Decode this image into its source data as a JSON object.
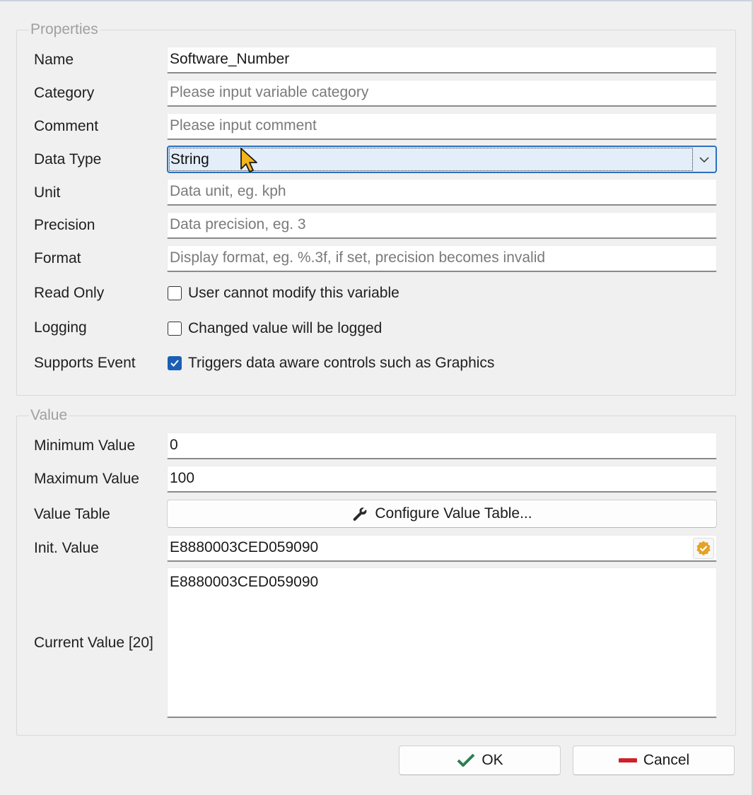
{
  "properties": {
    "legend": "Properties",
    "name": {
      "label": "Name",
      "value": "Software_Number"
    },
    "category": {
      "label": "Category",
      "placeholder": "Please input variable category"
    },
    "comment": {
      "label": "Comment",
      "placeholder": "Please input comment"
    },
    "data_type": {
      "label": "Data Type",
      "selected": "String"
    },
    "unit": {
      "label": "Unit",
      "placeholder": "Data unit, eg. kph"
    },
    "precision": {
      "label": "Precision",
      "placeholder": "Data precision, eg. 3"
    },
    "format": {
      "label": "Format",
      "placeholder": "Display format, eg. %.3f, if set, precision becomes invalid"
    },
    "read_only": {
      "label": "Read Only",
      "text": "User cannot modify this variable",
      "checked": false
    },
    "logging": {
      "label": "Logging",
      "text": "Changed value will be logged",
      "checked": false
    },
    "supports_event": {
      "label": "Supports Event",
      "text": "Triggers data aware controls such as Graphics",
      "checked": true
    }
  },
  "value": {
    "legend": "Value",
    "minimum": {
      "label": "Minimum Value",
      "value": "0"
    },
    "maximum": {
      "label": "Maximum Value",
      "value": "100"
    },
    "value_table": {
      "label": "Value Table",
      "button": "Configure Value Table..."
    },
    "init_value": {
      "label": "Init. Value",
      "value": "E8880003CED059090"
    },
    "current_value": {
      "label": "Current Value [20]",
      "value": "E8880003CED059090"
    }
  },
  "buttons": {
    "ok": "OK",
    "cancel": "Cancel"
  },
  "colors": {
    "accent": "#1a5fb4",
    "ok_check": "#2e7d4f",
    "cancel_bar": "#d0202a",
    "badge": "#e3a325"
  },
  "icons": [
    "chevron-down-icon",
    "wrench-icon",
    "verified-badge-icon",
    "checkmark-icon",
    "minus-icon",
    "mouse-cursor-icon"
  ]
}
